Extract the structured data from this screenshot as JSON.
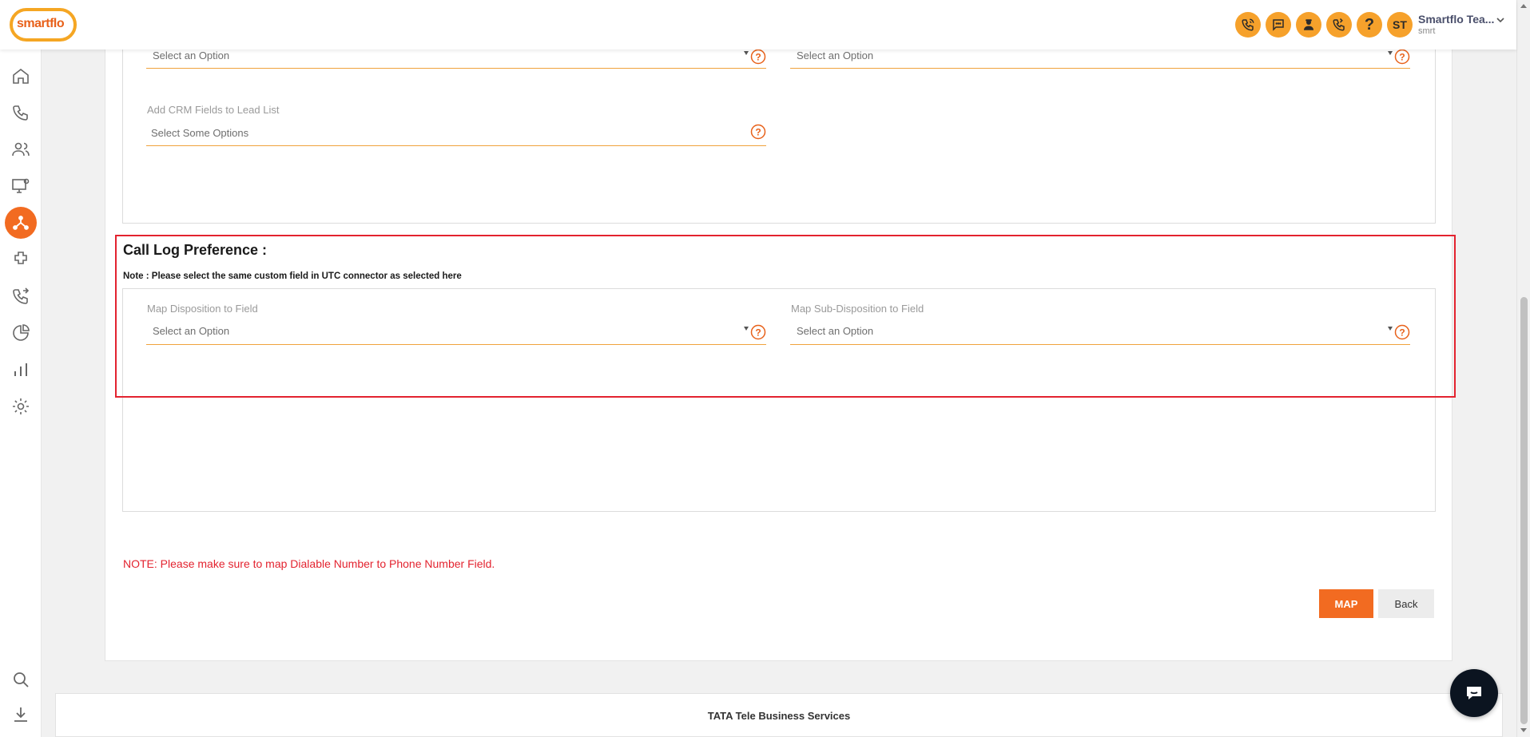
{
  "header": {
    "logo_text": "smartflo",
    "icons": [
      "call-icon",
      "sms-icon",
      "agent-icon",
      "phone-ring-icon",
      "help-icon"
    ],
    "help_glyph": "?",
    "avatar_initials": "ST",
    "user_name": "Smartflo Tea...",
    "user_sub": "smrt"
  },
  "sidebar": {
    "items": [
      "home-icon",
      "phone-icon",
      "users-icon",
      "monitor-settings-icon",
      "integrations-icon",
      "plugin-icon",
      "call-routing-icon",
      "pie-chart-icon",
      "bar-chart-icon",
      "settings-icon",
      "search-icon",
      "download-icon"
    ],
    "active": "integrations-icon"
  },
  "top_section": {
    "left_select_placeholder": "Select an Option",
    "right_select_placeholder": "Select an Option",
    "crm_fields_label": "Add CRM Fields to Lead List",
    "crm_fields_placeholder": "Select Some Options"
  },
  "call_log": {
    "title": "Call Log Preference :",
    "note": "Note : Please select the same custom field in UTC connector as selected here",
    "disposition_label": "Map Disposition to Field",
    "disposition_placeholder": "Select an Option",
    "sub_disposition_label": "Map Sub-Disposition to Field",
    "sub_disposition_placeholder": "Select an Option"
  },
  "red_note": "NOTE: Please make sure to map Dialable Number to Phone Number Field.",
  "buttons": {
    "map_label": "MAP",
    "back_label": "Back"
  },
  "footer": {
    "text": "TATA Tele Business Services"
  },
  "colors": {
    "accent": "#f26b21",
    "header_icon_bg": "#f6a12b",
    "input_underline": "#f0a23c",
    "error_red": "#e3232f"
  }
}
